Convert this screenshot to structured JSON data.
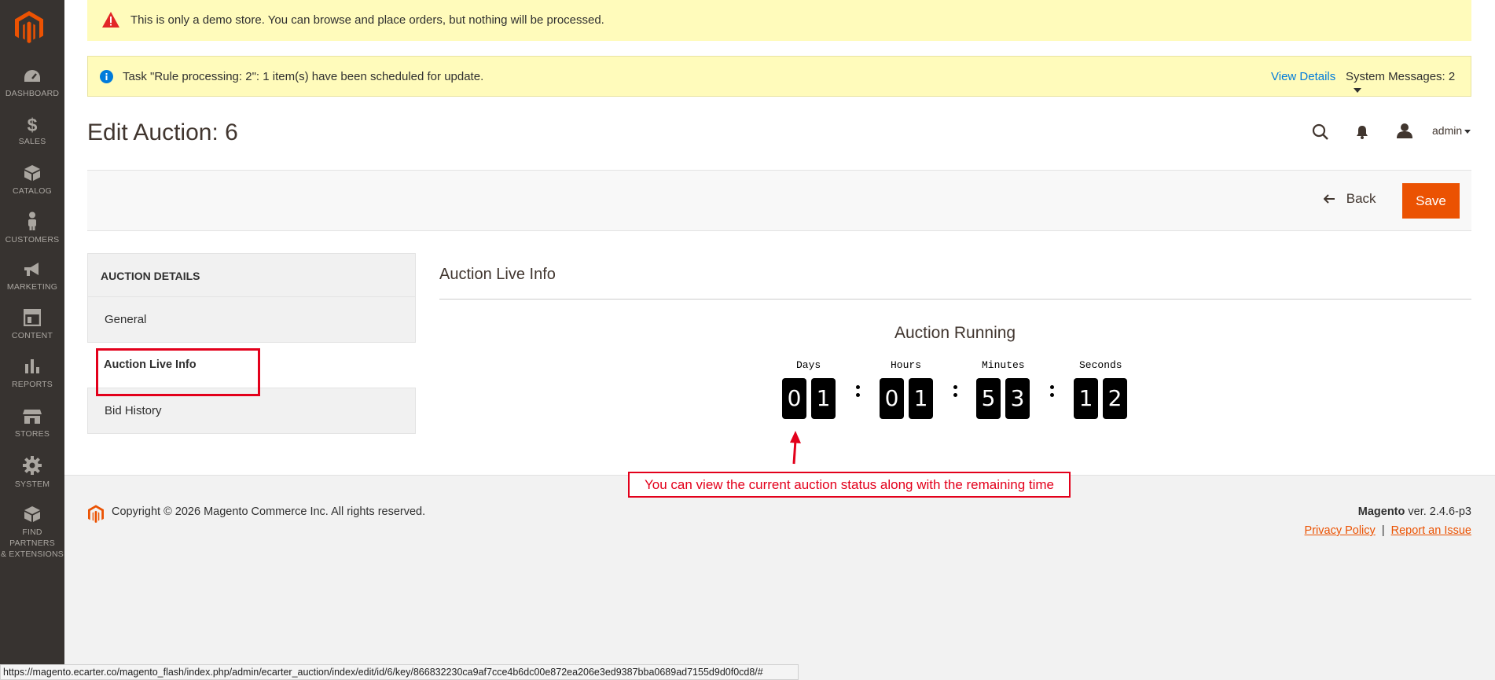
{
  "sidebar": {
    "items": [
      {
        "label": "DASHBOARD",
        "icon": "dashboard-icon"
      },
      {
        "label": "SALES",
        "icon": "dollar-icon"
      },
      {
        "label": "CATALOG",
        "icon": "box-icon"
      },
      {
        "label": "CUSTOMERS",
        "icon": "person-icon"
      },
      {
        "label": "MARKETING",
        "icon": "megaphone-icon"
      },
      {
        "label": "CONTENT",
        "icon": "layout-icon"
      },
      {
        "label": "REPORTS",
        "icon": "bar-chart-icon"
      },
      {
        "label": "STORES",
        "icon": "store-icon"
      },
      {
        "label": "SYSTEM",
        "icon": "gear-icon"
      },
      {
        "label_line1": "FIND PARTNERS",
        "label_line2": "& EXTENSIONS",
        "icon": "extensions-icon"
      }
    ]
  },
  "messages": {
    "demo": "This is only a demo store. You can browse and place orders, but nothing will be processed.",
    "task": "Task \"Rule processing: 2\": 1 item(s) have been scheduled for update.",
    "view_details": "View Details",
    "system_messages": "System Messages: 2"
  },
  "header": {
    "title": "Edit Auction: 6",
    "admin_user": "admin"
  },
  "actions": {
    "back": "Back",
    "save": "Save"
  },
  "tabs": {
    "title": "AUCTION DETAILS",
    "items": [
      "General",
      "Auction Live Info",
      "Bid History"
    ],
    "active": "Auction Live Info"
  },
  "main": {
    "section_title": "Auction Live Info",
    "status": "Auction Running",
    "countdown": {
      "days_label": "Days",
      "hours_label": "Hours",
      "minutes_label": "Minutes",
      "seconds_label": "Seconds",
      "days": [
        "0",
        "1"
      ],
      "hours": [
        "0",
        "1"
      ],
      "minutes": [
        "5",
        "3"
      ],
      "seconds": [
        "1",
        "2"
      ]
    },
    "annotation": "You can view the current auction status along with the remaining time"
  },
  "footer": {
    "copyright": "Copyright © 2026 Magento Commerce Inc. All rights reserved.",
    "brand": "Magento",
    "version": " ver. 2.4.6-p3",
    "privacy": "Privacy Policy",
    "separator": "|",
    "report": "Report an Issue"
  },
  "status_url": "https://magento.ecarter.co/magento_flash/index.php/admin/ecarter_auction/index/edit/id/6/key/866832230ca9af7cce4b6dc00e872ea206e3ed9387bba0689ad7155d9d0f0cd8/#",
  "colors": {
    "sidebar": "#373330",
    "accent": "#eb5202",
    "notice_bg": "#fffbbb",
    "link": "#007bdb",
    "annotation": "#e3001b"
  }
}
